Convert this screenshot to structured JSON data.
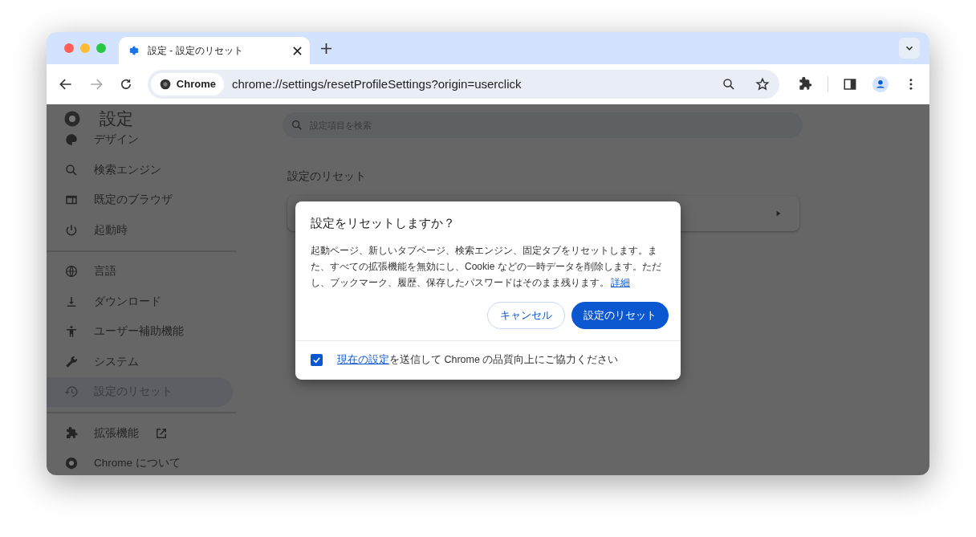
{
  "tabs": [
    {
      "title": "設定 - 設定のリセット",
      "selected": true
    }
  ],
  "toolbar": {
    "chip": "Chrome",
    "url": "chrome://settings/resetProfileSettings?origin=userclick"
  },
  "sidebar": {
    "title": "設定",
    "items": [
      {
        "label": "デザイン",
        "selected": false
      },
      {
        "label": "検索エンジン",
        "selected": false
      },
      {
        "label": "既定のブラウザ",
        "selected": false
      },
      {
        "label": "起動時",
        "selected": false,
        "divider_after": true
      },
      {
        "label": "言語",
        "selected": false
      },
      {
        "label": "ダウンロード",
        "selected": false
      },
      {
        "label": "ユーザー補助機能",
        "selected": false
      },
      {
        "label": "システム",
        "selected": false
      },
      {
        "label": "設定のリセット",
        "selected": true,
        "divider_after": true
      },
      {
        "label": "拡張機能",
        "selected": false,
        "external": true
      },
      {
        "label": "Chrome について",
        "selected": false
      }
    ]
  },
  "search": {
    "placeholder": "設定項目を検索"
  },
  "section_title": "設定のリセット",
  "dialog": {
    "title": "設定をリセットしますか？",
    "body": "起動ページ、新しいタブページ、検索エンジン、固定タブをリセットします。また、すべての拡張機能を無効にし、Cookie などの一時データを削除します。ただし、ブックマーク、履歴、保存したパスワードはそのまま残ります。",
    "link": "詳細",
    "cancel": "キャンセル",
    "confirm": "設定のリセット",
    "checkbox": {
      "checked": true,
      "link": "現在の設定",
      "text": "を送信して Chrome の品質向上にご協力ください"
    }
  }
}
